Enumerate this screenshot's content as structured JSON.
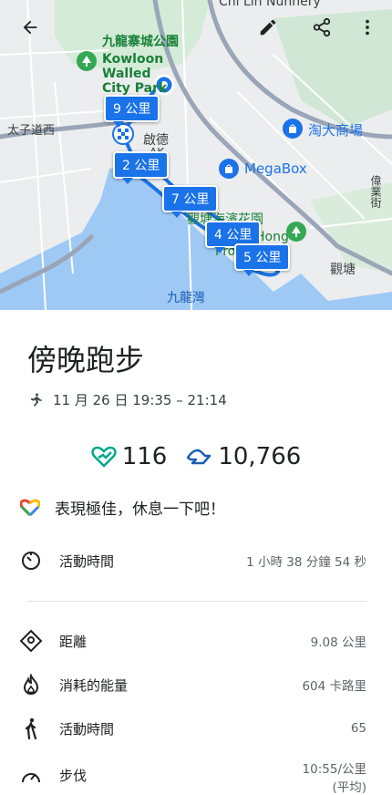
{
  "map": {
    "labels": {
      "chi_lin": "Chi Lin Nunnery",
      "park_zh": "九龍寨城公園",
      "park_en1": "Kowloon",
      "park_en2": "Walled",
      "park_en3": "City Park",
      "tai_tsz": "太子道西",
      "kai_tak": "啟德",
      "kai_tak_en": "AK",
      "taitai": "淘大商場",
      "megabox": "MegaBox",
      "kwun_tong_park": "觀塘海濱花園",
      "kowloon_bay": "九龍灣",
      "kwun_tong": "觀塘",
      "hong": "Hong",
      "prom": "Pro",
      "road_right": "偉業街"
    },
    "markers": {
      "km9": "9 公里",
      "km2": "2 公里",
      "km7": "7 公里",
      "km4": "4 公里",
      "km5": "5 公里"
    },
    "colors": {
      "route": "#1a73e8",
      "water": "#9fc9f5",
      "park": "#cde8d2",
      "land": "#ecedef"
    }
  },
  "toolbar": {
    "back_icon": "arrow-back-icon",
    "edit_icon": "pencil-icon",
    "share_icon": "share-icon",
    "more_icon": "more-vert-icon"
  },
  "activity": {
    "title": "傍晚跑步",
    "time_range": "11 月 26 日 19:35 – 21:14",
    "heart_points": "116",
    "steps": "10,766",
    "message": "表現極佳，休息一下吧！"
  },
  "metrics": [
    {
      "label": "活動時間",
      "value": "1 小時 38 分鐘 54 秒",
      "icon": "timer-icon"
    },
    {
      "label": "距離",
      "value": "9.08 公里",
      "icon": "location-diamond-icon"
    },
    {
      "label": "消耗的能量",
      "value": "604 卡路里",
      "icon": "flame-icon"
    },
    {
      "label": "活動時間",
      "value": "65",
      "icon": "walking-person-icon"
    },
    {
      "label": "步伐",
      "value": "10:55/公里",
      "value2": "(平均)",
      "icon": "speedometer-icon"
    }
  ]
}
